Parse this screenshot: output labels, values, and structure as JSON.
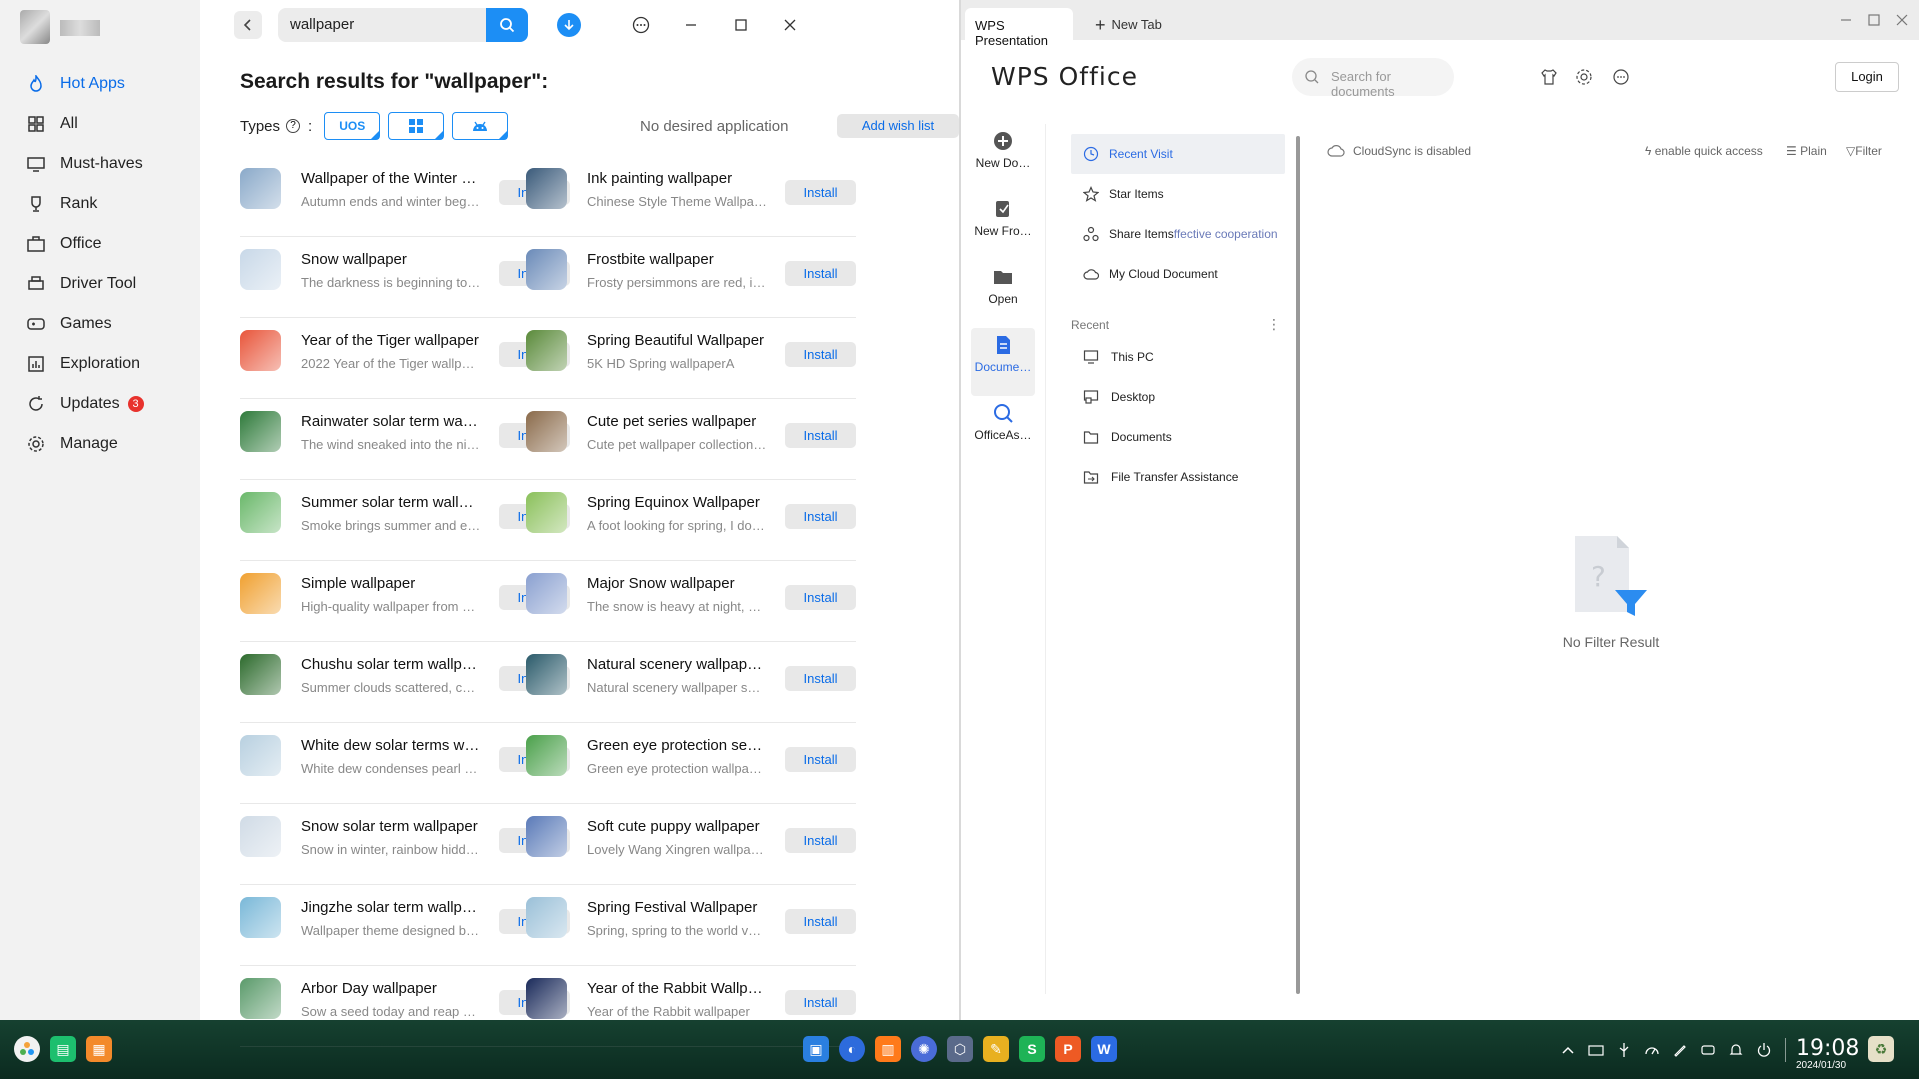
{
  "store": {
    "nav": [
      {
        "label": "Hot Apps",
        "icon": "fire-icon",
        "active": true
      },
      {
        "label": "All",
        "icon": "grid-icon"
      },
      {
        "label": "Must-haves",
        "icon": "monitor-icon"
      },
      {
        "label": "Rank",
        "icon": "trophy-icon"
      },
      {
        "label": "Office",
        "icon": "briefcase-icon"
      },
      {
        "label": "Driver Tool",
        "icon": "printer-icon"
      },
      {
        "label": "Games",
        "icon": "gamepad-icon"
      },
      {
        "label": "Exploration",
        "icon": "chart-icon"
      },
      {
        "label": "Updates",
        "icon": "refresh-icon",
        "badge": "3"
      },
      {
        "label": "Manage",
        "icon": "gear-icon"
      }
    ],
    "search": {
      "value": "wallpaper"
    },
    "results_title": "Search results for \"wallpaper\":",
    "types_label": "Types",
    "type_buttons": [
      "UOS",
      "windows",
      "android"
    ],
    "no_desired": "No desired application",
    "wish_button": "Add wish list",
    "install_label": "Install",
    "left_apps": [
      {
        "name": "Wallpaper of the Winter F…",
        "desc": "Autumn ends and winter begi…",
        "color": "#8aa9c9"
      },
      {
        "name": "Snow wallpaper",
        "desc": "The darkness is beginning to f…",
        "color": "#c8d8e8"
      },
      {
        "name": "Year of the Tiger wallpaper",
        "desc": "2022 Year of the Tiger wallpaper",
        "color": "#e8553a"
      },
      {
        "name": "Rainwater solar term wal…",
        "desc": "The wind sneaked into the ni…",
        "color": "#2e7a3a"
      },
      {
        "name": "Summer solar term wall…",
        "desc": "Smoke brings summer and ev…",
        "color": "#6ab86a"
      },
      {
        "name": "Simple wallpaper",
        "desc": "High-quality wallpaper from …",
        "color": "#f0a030"
      },
      {
        "name": "Chushu solar term wallp…",
        "desc": "Summer clouds scattered, co…",
        "color": "#2c6a2c"
      },
      {
        "name": "White dew solar terms w…",
        "desc": "White dew condenses pearl …",
        "color": "#b8d0e0"
      },
      {
        "name": "Snow solar term wallpaper",
        "desc": "Snow in winter, rainbow hidd…",
        "color": "#d0dbe6"
      },
      {
        "name": "Jingzhe solar term wallp…",
        "desc": "Wallpaper theme designed by…",
        "color": "#7ab8d8"
      },
      {
        "name": "Arbor Day wallpaper",
        "desc": "Sow a seed today and reap a …",
        "color": "#5a9a6a"
      }
    ],
    "right_apps": [
      {
        "name": "Ink painting wallpaper",
        "desc": "Chinese Style Theme Wallpap…",
        "color": "#3a5a7a"
      },
      {
        "name": "Frostbite wallpaper",
        "desc": "Frosty persimmons are red, it'…",
        "color": "#6a8ab8"
      },
      {
        "name": "Spring Beautiful Wallpaper",
        "desc": "5K HD Spring wallpaperA",
        "color": "#5a8a3a"
      },
      {
        "name": "Cute pet series wallpaper",
        "desc": "Cute pet wallpaper collection…",
        "color": "#8a6a4a"
      },
      {
        "name": "Spring Equinox Wallpaper",
        "desc": "A foot looking for spring, I do…",
        "color": "#8ac05a"
      },
      {
        "name": "Major Snow wallpaper",
        "desc": "The snow is heavy at night, a…",
        "color": "#8aa0d0"
      },
      {
        "name": "Natural scenery wallpap…",
        "desc": "Natural scenery wallpaper ser…",
        "color": "#2a5a6a"
      },
      {
        "name": "Green eye protection seri…",
        "desc": "Green eye protection wallpap…",
        "color": "#4aa04a"
      },
      {
        "name": "Soft cute puppy wallpaper",
        "desc": "Lovely Wang Xingren wallpaper",
        "color": "#5a7ab8"
      },
      {
        "name": "Spring Festival Wallpaper",
        "desc": "Spring, spring to the world ve…",
        "color": "#9ac0d8"
      },
      {
        "name": "Year of the Rabbit Wallpa…",
        "desc": "Year of the Rabbit wallpaper",
        "color": "#1a2a5a"
      }
    ]
  },
  "wps": {
    "tab": "WPS Presentation",
    "new_tab": "New Tab",
    "logo": "WPS Office",
    "search_placeholder": "Search for documents",
    "login": "Login",
    "left_items": [
      {
        "label": "New Do…",
        "icon": "plus-circle-icon"
      },
      {
        "label": "New Fro…",
        "icon": "new-from-template-icon"
      },
      {
        "label": "Open",
        "icon": "folder-icon"
      },
      {
        "label": "Docume…",
        "icon": "document-icon",
        "active": true
      },
      {
        "label": "OfficeAs…",
        "icon": "office-assistant-icon"
      }
    ],
    "nav_items": [
      {
        "label": "Recent Visit",
        "icon": "clock-icon",
        "active": true
      },
      {
        "label": "Star Items",
        "icon": "star-icon"
      },
      {
        "label": "Share Items",
        "extra": "ffective cooperation",
        "icon": "share-icon"
      },
      {
        "label": "My Cloud Document",
        "icon": "cloud-icon"
      }
    ],
    "recent_label": "Recent",
    "recent_items": [
      {
        "label": "This PC",
        "icon": "computer-icon"
      },
      {
        "label": "Desktop",
        "icon": "desktop-icon"
      },
      {
        "label": "Documents",
        "icon": "documents-folder-icon"
      },
      {
        "label": "File Transfer Assistance",
        "icon": "file-transfer-icon"
      }
    ],
    "cloud_sync": "CloudSync is disabled",
    "quick_access": "enable quick access",
    "plain": "Plain",
    "filter": "Filter",
    "empty_text": "No Filter Result"
  },
  "taskbar": {
    "time": "19:08",
    "date": "2024/01/30"
  },
  "colors": {
    "accent": "#1c8ef5",
    "link": "#0a6ce8",
    "badge": "#e8322d"
  }
}
